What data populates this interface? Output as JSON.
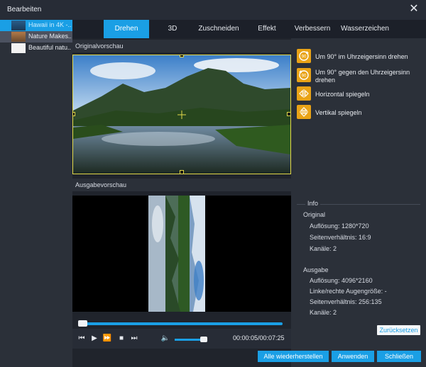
{
  "window": {
    "title": "Bearbeiten",
    "close_glyph": "✕"
  },
  "sidebar": {
    "items": [
      {
        "label": "Hawaii in 4K -...",
        "active": true
      },
      {
        "label": "Nature Makes...",
        "active": false
      },
      {
        "label": "Beautiful natu...",
        "active": false
      }
    ]
  },
  "tabs": [
    {
      "label": "Drehen",
      "active": true
    },
    {
      "label": "3D"
    },
    {
      "label": "Zuschneiden"
    },
    {
      "label": "Effekt"
    },
    {
      "label": "Verbessern"
    },
    {
      "label": "Wasserzeichen"
    }
  ],
  "preview": {
    "original_label": "Originalvorschau",
    "output_label": "Ausgabevorschau",
    "timecode": "00:00:05/00:07:25"
  },
  "rotate": {
    "cw_label": "Um 90° im Uhrzeigersinn drehen",
    "ccw_label": "Um 90° gegen den Uhrzeigersinn drehen",
    "hflip_label": "Horizontal spiegeln",
    "vflip_label": "Vertikal spiegeln",
    "badge_90": "90"
  },
  "info": {
    "title": "Info",
    "original_heading": "Original",
    "original_resolution": "Auflösung: 1280*720",
    "original_aspect": "Seitenverhältnis: 16:9",
    "original_channels": "Kanäle: 2",
    "output_heading": "Ausgabe",
    "output_resolution": "Auflösung: 4096*2160",
    "output_eye": "Linke/rechte Augengröße: -",
    "output_aspect": "Seitenverhältnis: 256:135",
    "output_channels": "Kanäle: 2"
  },
  "buttons": {
    "reset": "Zurücksetzen",
    "restore_all": "Alle wiederherstellen",
    "apply": "Anwenden",
    "close": "Schließen"
  },
  "colors": {
    "accent": "#1a9fe5",
    "rotate_icon": "#e9a316",
    "crop_frame": "#e3d94a"
  }
}
